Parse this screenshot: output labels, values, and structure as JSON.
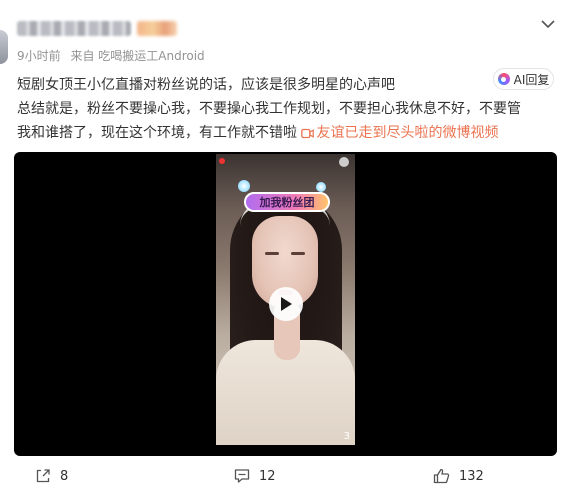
{
  "post": {
    "author_name": "",
    "meta": {
      "time": "9小时前",
      "source": "来自 吃喝搬运工Android"
    },
    "text_lines": [
      "短剧女顶王小亿直播对粉丝说的话，应该是很多明星的心声吧",
      "总结就是，粉丝不要操心我，不要操心我工作规划，不要担心我休息不好，不要管",
      "我和谁搭了，现在这个环境，有工作就不错啦"
    ],
    "video_link_label": "友谊已走到尽头啦的微博视频",
    "ai_reply_label": "AI回复"
  },
  "video": {
    "overlay_badge_text": "加我粉丝团",
    "corner_text": "3"
  },
  "actions": {
    "share_count": "8",
    "comment_count": "12",
    "like_count": "132"
  },
  "colors": {
    "link": "#eb7350",
    "meta_gray": "#939393",
    "text": "#333333",
    "video_bg": "#000000"
  },
  "icons": [
    "chevron-down-icon",
    "video-camera-icon",
    "ai-icon",
    "play-icon",
    "share-icon",
    "comment-icon",
    "like-icon"
  ]
}
